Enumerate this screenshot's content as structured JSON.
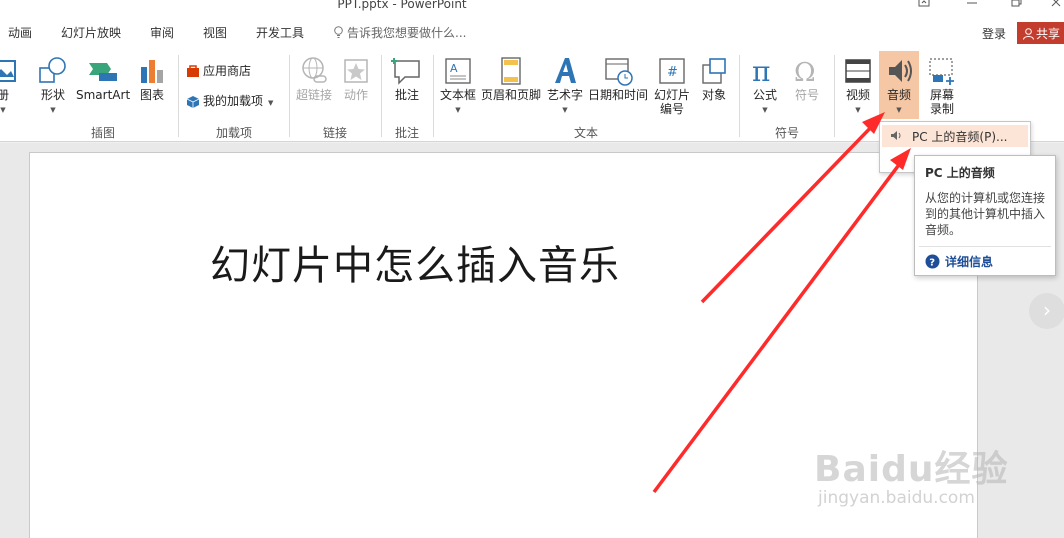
{
  "window": {
    "title": "PPT.pptx - PowerPoint"
  },
  "tabs": [
    {
      "label": "动画"
    },
    {
      "label": "幻灯片放映"
    },
    {
      "label": "审阅"
    },
    {
      "label": "视图"
    },
    {
      "label": "开发工具"
    }
  ],
  "tell_me": {
    "placeholder": "告诉我您想要做什么..."
  },
  "account": {
    "login_label": "登录",
    "share_label": "共享"
  },
  "ribbon": {
    "buttons": {
      "album": "册",
      "shapes": "形状",
      "smartart": "SmartArt",
      "chart": "图表",
      "hyperlink": "超链接",
      "action": "动作",
      "comment": "批注",
      "textbox": "文本框",
      "header_footer": "页眉和页脚",
      "wordart": "艺术字",
      "datetime": "日期和时间",
      "slide_number_1": "幻灯片",
      "slide_number_2": "编号",
      "object": "对象",
      "equation": "公式",
      "symbol": "符号",
      "video": "视频",
      "audio": "音频",
      "screen_recording_1": "屏幕",
      "screen_recording_2": "录制"
    },
    "addins": {
      "store": "应用商店",
      "my_addins": "我的加载项"
    },
    "groups": {
      "illustrations": "插图",
      "addins": "加载项",
      "links": "链接",
      "comments": "批注",
      "text": "文本",
      "symbols": "符号"
    }
  },
  "audio_dropdown": {
    "item_label": "PC 上的音频(P)..."
  },
  "tooltip": {
    "title": "PC 上的音频",
    "description": "从您的计算机或您连接到的其他计算机中插入音频。",
    "more_info": "详细信息"
  },
  "slide": {
    "title": "幻灯片中怎么插入音乐"
  },
  "watermark": {
    "brand": "Baidu经验",
    "url": "jingyan.baidu.com"
  },
  "colors": {
    "share_bg": "#c33d2f",
    "active_button": "#f6c7a4",
    "arrow": "#ff2a2a",
    "link_blue": "#1f4e99"
  }
}
